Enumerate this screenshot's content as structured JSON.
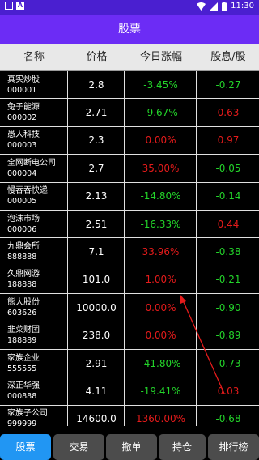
{
  "status_bar": {
    "time": "11:30",
    "icon_left_1": "sim-card-icon",
    "icon_left_2": "font-icon",
    "icons_right": [
      "wifi-icon",
      "signal-icon",
      "battery-icon"
    ]
  },
  "app_bar": {
    "title": "股票"
  },
  "table": {
    "headers": {
      "name": "名称",
      "price": "价格",
      "change": "今日涨幅",
      "dividend": "股息/股"
    },
    "rows": [
      {
        "name": "真实炒股",
        "code": "000001",
        "price": "2.8",
        "change": "-3.45%",
        "dividend": "-0.27",
        "change_color": "green",
        "dividend_color": "green"
      },
      {
        "name": "兔子能源",
        "code": "000002",
        "price": "2.71",
        "change": "-9.67%",
        "dividend": "0.63",
        "change_color": "green",
        "dividend_color": "red"
      },
      {
        "name": "愚人科技",
        "code": "000003",
        "price": "2.3",
        "change": "0.00%",
        "dividend": "0.97",
        "change_color": "red",
        "dividend_color": "red"
      },
      {
        "name": "全网断电公司",
        "code": "000004",
        "price": "2.7",
        "change": "35.00%",
        "dividend": "-0.05",
        "change_color": "red",
        "dividend_color": "green"
      },
      {
        "name": "慢吞吞快递",
        "code": "000005",
        "price": "2.13",
        "change": "-14.80%",
        "dividend": "-0.14",
        "change_color": "green",
        "dividend_color": "green"
      },
      {
        "name": "泡沫市场",
        "code": "000006",
        "price": "2.51",
        "change": "-16.33%",
        "dividend": "0.44",
        "change_color": "green",
        "dividend_color": "red"
      },
      {
        "name": "九鼎会所",
        "code": "888888",
        "price": "7.1",
        "change": "33.96%",
        "dividend": "-0.38",
        "change_color": "red",
        "dividend_color": "green"
      },
      {
        "name": "久鼎网游",
        "code": "188888",
        "price": "101.0",
        "change": "1.00%",
        "dividend": "-0.21",
        "change_color": "red",
        "dividend_color": "green"
      },
      {
        "name": "熊大股份",
        "code": "603626",
        "price": "10000.0",
        "change": "0.00%",
        "dividend": "-0.90",
        "change_color": "red",
        "dividend_color": "green"
      },
      {
        "name": "韭菜财团",
        "code": "188889",
        "price": "238.0",
        "change": "0.00%",
        "dividend": "-0.89",
        "change_color": "red",
        "dividend_color": "green"
      },
      {
        "name": "家族企业",
        "code": "555555",
        "price": "2.91",
        "change": "-41.80%",
        "dividend": "-0.73",
        "change_color": "green",
        "dividend_color": "green"
      },
      {
        "name": "深正华强",
        "code": "000888",
        "price": "4.11",
        "change": "-19.41%",
        "dividend": "0.03",
        "change_color": "green",
        "dividend_color": "red"
      },
      {
        "name": "家族子公司",
        "code": "999999",
        "price": "14600.0",
        "change": "1360.00%",
        "dividend": "-0.68",
        "change_color": "red",
        "dividend_color": "green"
      }
    ]
  },
  "tabs": [
    {
      "label": "股票",
      "active": true
    },
    {
      "label": "交易",
      "active": false
    },
    {
      "label": "撤单",
      "active": false
    },
    {
      "label": "持仓",
      "active": false
    },
    {
      "label": "排行榜",
      "active": false
    }
  ],
  "colors": {
    "status_bar": "#4a1fd0",
    "app_bar": "#6c2cf5",
    "up": "#e51b1b",
    "down": "#23d42a",
    "active_tab": "#2196f3",
    "tab": "#4c4c4c",
    "annotation_arrow": "#e51b1b"
  }
}
